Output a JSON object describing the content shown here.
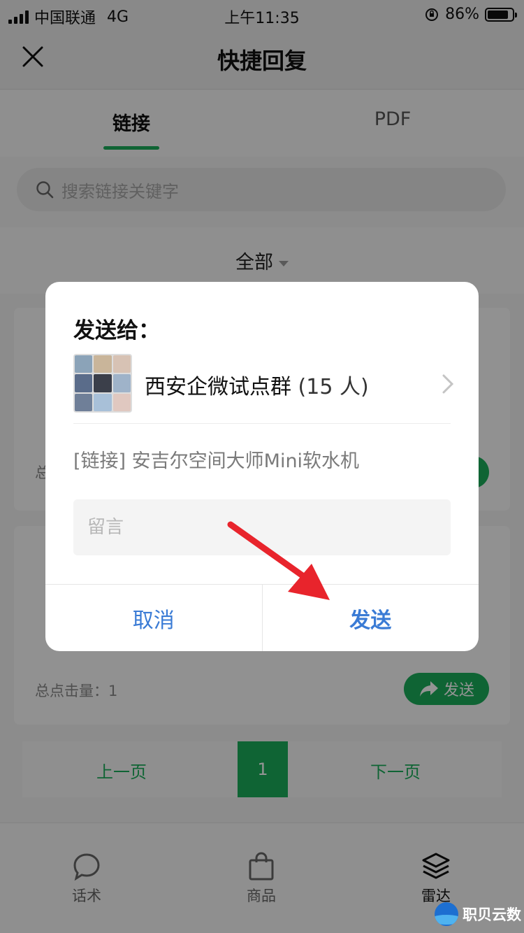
{
  "status_bar": {
    "carrier": "中国联通",
    "network": "4G",
    "time": "上午11:35",
    "battery": "86%",
    "battery_level": 0.86
  },
  "header": {
    "title": "快捷回复"
  },
  "tabs": [
    {
      "label": "链接",
      "active": true
    },
    {
      "label": "PDF",
      "active": false
    }
  ],
  "search": {
    "placeholder": "搜索链接关键字"
  },
  "filter": {
    "label": "全部"
  },
  "cards": [
    {
      "meta": "总",
      "send_label": ""
    },
    {
      "meta": "总点击量：1",
      "send_label": "发送"
    }
  ],
  "pager": {
    "prev": "上一页",
    "current": "1",
    "next": "下一页"
  },
  "bottom_tabs": [
    {
      "label": "话术",
      "icon": "chat-bubble-icon"
    },
    {
      "label": "商品",
      "icon": "shopping-bag-icon"
    },
    {
      "label": "雷达",
      "icon": "layers-icon"
    }
  ],
  "dialog": {
    "title": "发送给：",
    "group_name": "西安企微试点群",
    "group_count": "(15 人)",
    "link_desc": "[链接] 安吉尔空间大师Mini软水机",
    "message_placeholder": "留言",
    "cancel": "取消",
    "send": "发送"
  },
  "watermark": {
    "text": "职贝云数"
  },
  "colors": {
    "accent_green": "#1aad5a",
    "dialog_button_blue": "#3a7bd5",
    "annotation_arrow": "#e8242c"
  }
}
